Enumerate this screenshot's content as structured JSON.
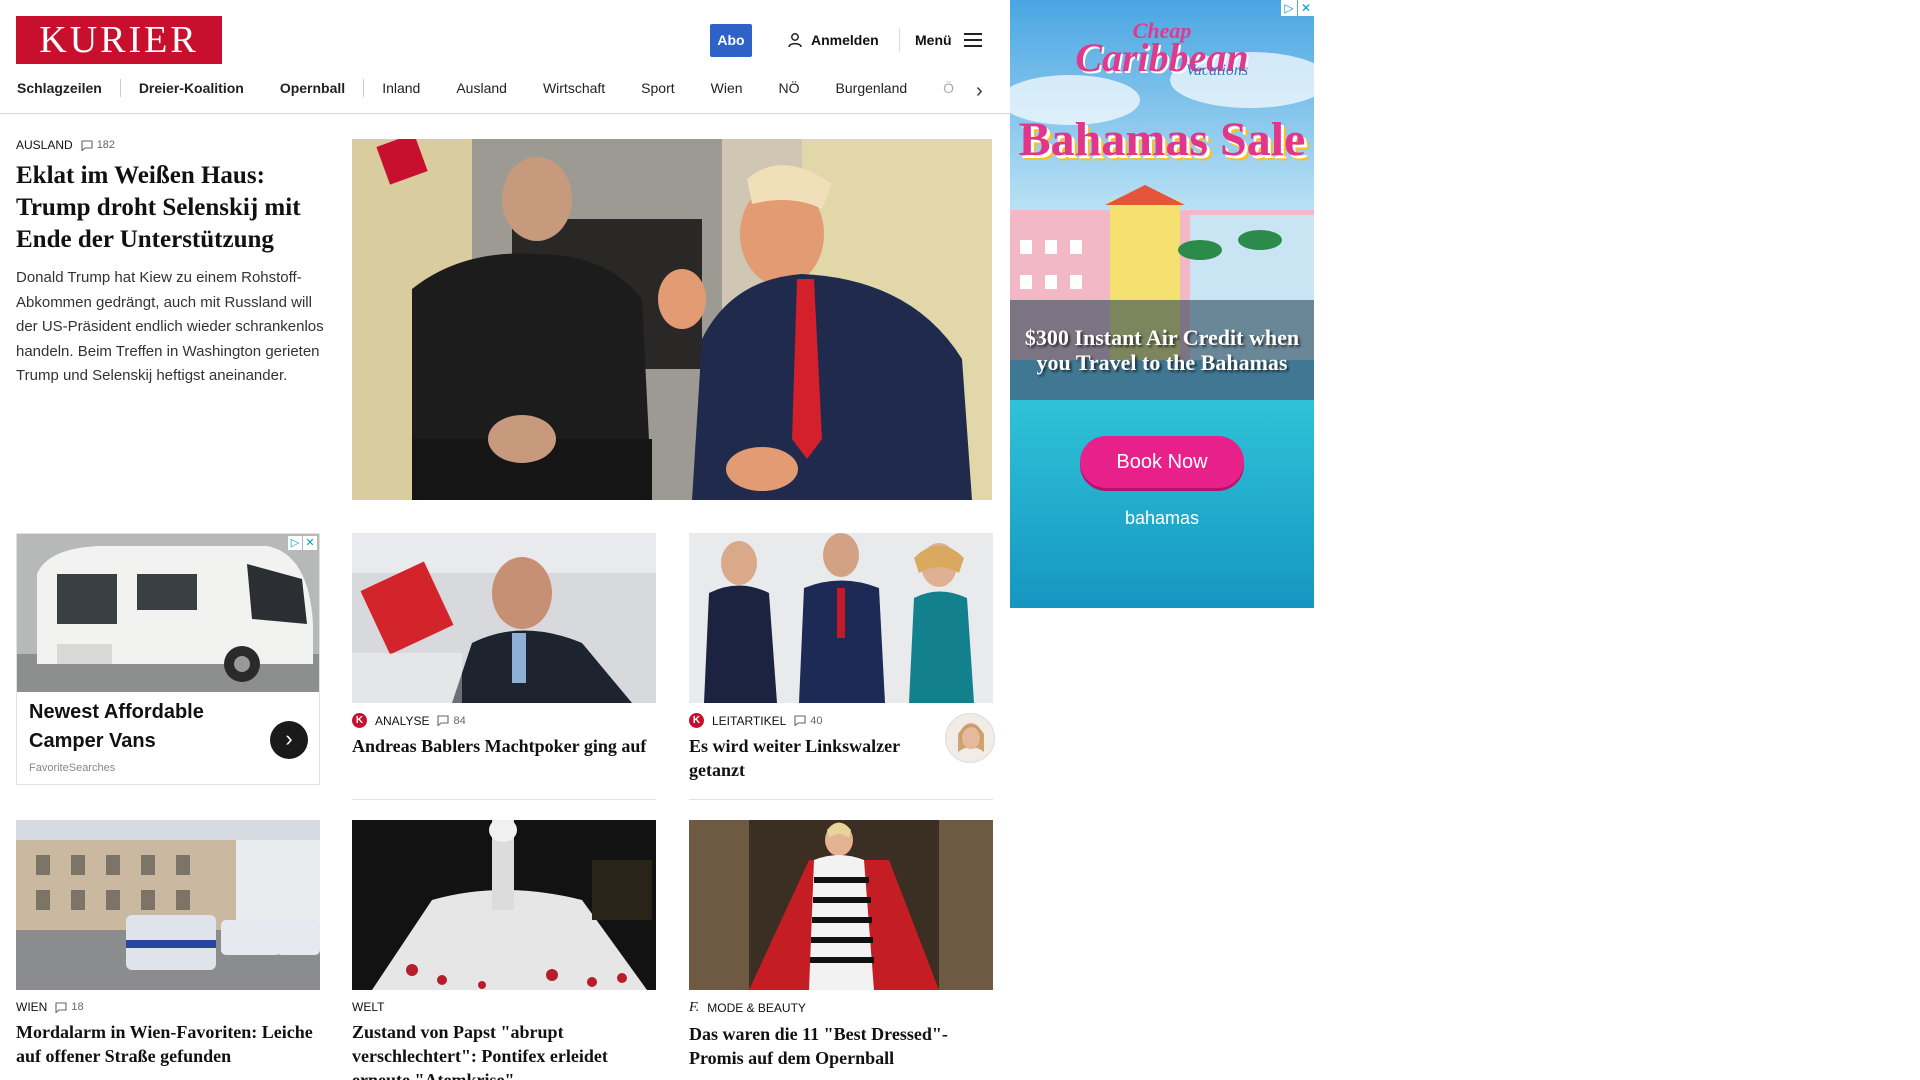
{
  "header": {
    "logo": "KURIER",
    "abo": "Abo",
    "login": "Anmelden",
    "menu": "Menü"
  },
  "nav": {
    "items": [
      "Schlagzeilen",
      "Dreier-Koalition",
      "Opernball",
      "Inland",
      "Ausland",
      "Wirtschaft",
      "Sport",
      "Wien",
      "NÖ",
      "Burgenland",
      "Ö"
    ]
  },
  "lead": {
    "kicker": "AUSLAND",
    "comments": "182",
    "title": "Eklat im Weißen Haus: Trump droht Selenskij mit Ende der Unterstützung",
    "teaser": "Donald Trump hat Kiew zu einem Rohstoff-Abkommen gedrängt, auch mit Russland will der US-Präsident endlich wieder schrankenlos handeln. Beim Treffen in Washington gerieten Trump und Selenskij heftigst aneinander."
  },
  "camper_ad": {
    "title": "Newest Affordable Camper Vans",
    "source": "FavoriteSearches"
  },
  "cards": [
    {
      "kicker": "ANALYSE",
      "comments": "84",
      "title": "Andreas Bablers Machtpoker ging auf"
    },
    {
      "kicker": "LEITARTIKEL",
      "comments": "40",
      "title": "Es wird weiter Linkswalzer getanzt"
    },
    {
      "kicker": "WIEN",
      "comments": "18",
      "title": "Mordalarm in Wien-Favoriten: Leiche auf offener Straße gefunden"
    },
    {
      "kicker": "WELT",
      "comments": "",
      "title": "Zustand von Papst \"abrupt verschlechtert\": Pontifex erleidet erneute \"Atemkrise\""
    },
    {
      "kicker": "MODE & BEAUTY",
      "comments": "",
      "title": "Das waren die 11 \"Best Dressed\"-Promis auf dem Opernball"
    }
  ],
  "side_ad": {
    "cheap": "Cheap",
    "caribbean": "Caribbean",
    "vacations": "Vacations",
    "sale": "Bahamas Sale",
    "credit": "$300 Instant Air Credit when you Travel to the Bahamas",
    "button": "Book Now",
    "brand": "bahamas"
  },
  "colors": {
    "brand_red": "#c8102e",
    "abo_blue": "#2f62c9",
    "ad_pink": "#e8208a"
  }
}
